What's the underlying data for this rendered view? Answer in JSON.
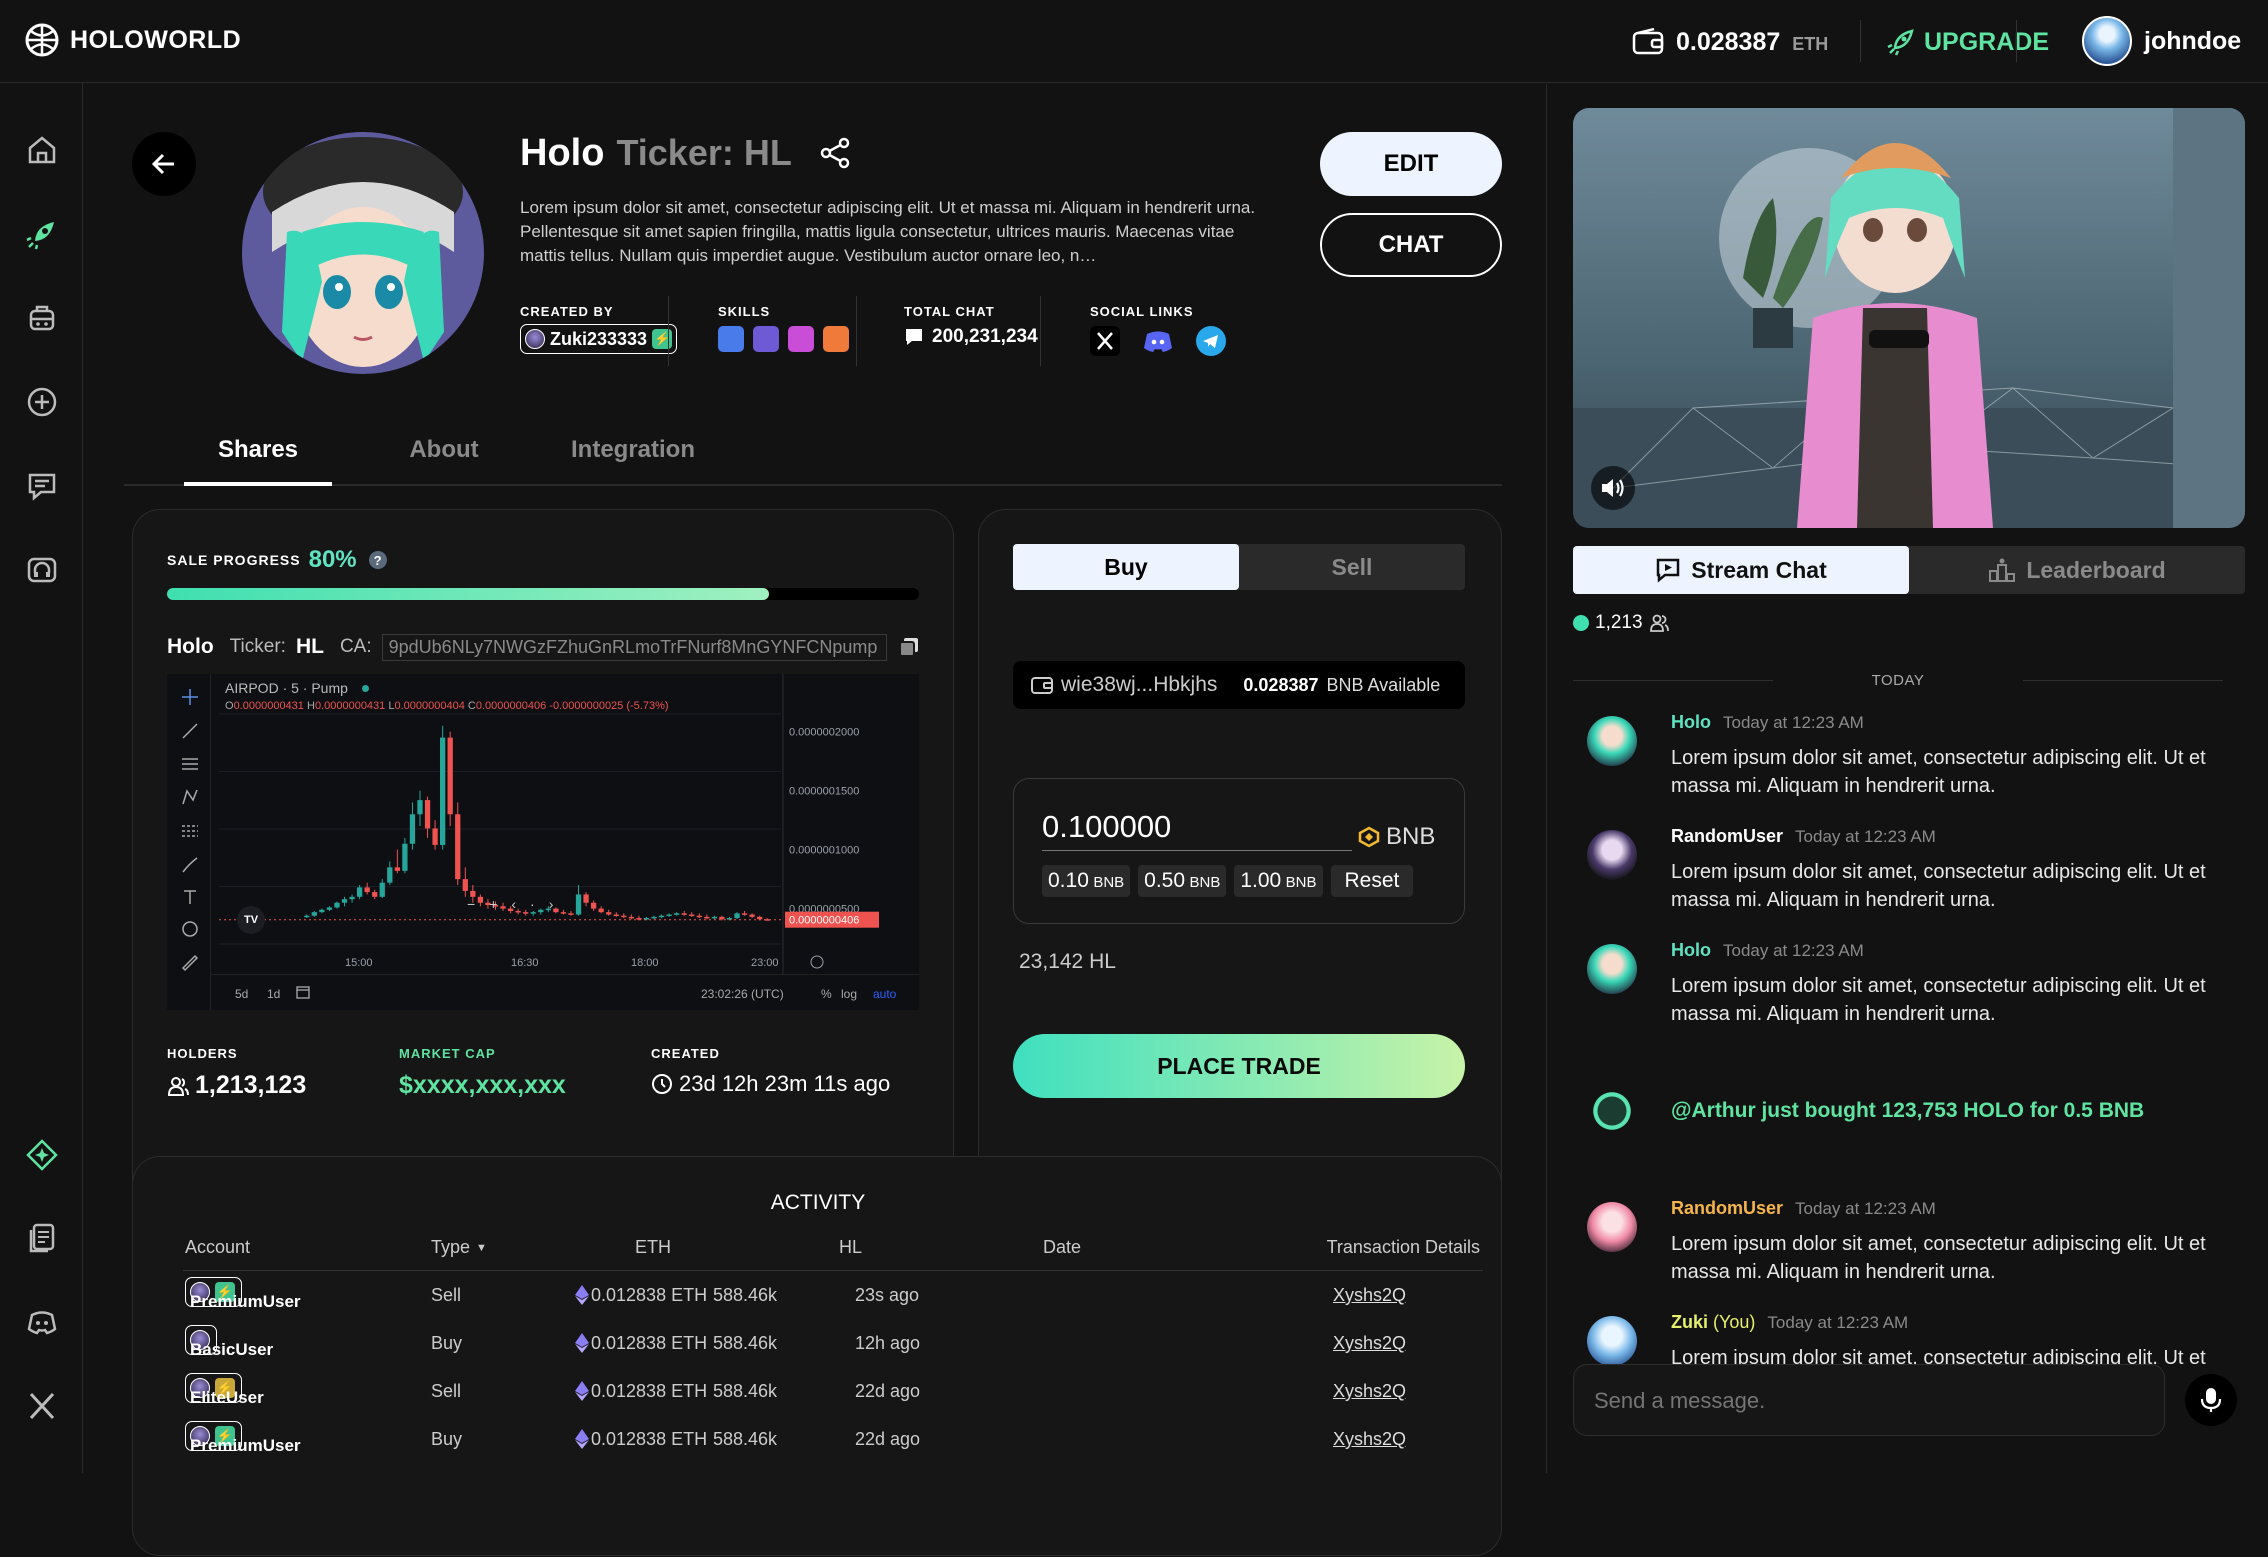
{
  "topbar": {
    "brand": "HOLOWORLD",
    "balance_value": "0.028387",
    "balance_unit": "ETH",
    "upgrade_label": "UPGRADE",
    "username": "johndoe"
  },
  "profile": {
    "name": "Holo",
    "ticker": "Ticker: HL",
    "description": "Lorem ipsum dolor sit amet, consectetur adipiscing elit. Ut et massa mi. Aliquam in hendrerit urna. Pellentesque sit amet sapien fringilla, mattis ligula consectetur, ultrices mauris. Maecenas vitae mattis tellus. Nullam quis imperdiet augue. Vestibulum auctor ornare leo, n…",
    "created_by_label": "CREATED BY",
    "creator": "Zuki233333",
    "skills_label": "SKILLS",
    "total_chat_label": "TOTAL CHAT",
    "total_chat": "200,231,234",
    "social_label": "SOCIAL LINKS",
    "edit_label": "EDIT",
    "chat_label": "CHAT"
  },
  "tabs": [
    {
      "label": "Shares",
      "active": true
    },
    {
      "label": "About",
      "active": false
    },
    {
      "label": "Integration",
      "active": false
    }
  ],
  "sale": {
    "label": "SALE PROGRESS",
    "percent_text": "80%",
    "progress": 0.8,
    "token_name": "Holo",
    "ticker_label": "Ticker:",
    "ticker": "HL",
    "ca_label": "CA:",
    "ca": "9pdUb6NLy7NWGzFZhuGnRLmoTrFNurf8MnGYNFCNpump"
  },
  "chart_data": {
    "type": "candlestick",
    "title": "AIRPOD · 5 · Pump",
    "ohlc_text": {
      "o": "0.0000000431",
      "h": "0.0000000431",
      "l": "0.0000000404",
      "c": "0.0000000406",
      "chg": "-0.0000000025 (-5.73%)"
    },
    "y_ticks": [
      "0.0000002000",
      "0.0000001500",
      "0.0000001000",
      "0.0000000500"
    ],
    "last_price": "0.0000000406",
    "x_ticks": [
      "15:00",
      "16:30",
      "18:00",
      "23:00"
    ],
    "timeframes": [
      "5d",
      "1d"
    ],
    "clock": "23:02:26 (UTC)",
    "scale_opts": [
      "%",
      "log",
      "auto"
    ],
    "candles": [
      [
        43,
        45,
        42,
        44
      ],
      [
        44,
        48,
        43,
        47
      ],
      [
        47,
        50,
        46,
        49
      ],
      [
        49,
        52,
        48,
        51
      ],
      [
        51,
        56,
        50,
        55
      ],
      [
        55,
        60,
        52,
        58
      ],
      [
        58,
        62,
        55,
        60
      ],
      [
        60,
        70,
        58,
        68
      ],
      [
        68,
        72,
        62,
        64
      ],
      [
        64,
        66,
        58,
        60
      ],
      [
        60,
        75,
        59,
        72
      ],
      [
        72,
        90,
        70,
        85
      ],
      [
        85,
        100,
        80,
        82
      ],
      [
        82,
        110,
        80,
        105
      ],
      [
        105,
        140,
        100,
        130
      ],
      [
        130,
        150,
        120,
        142
      ],
      [
        142,
        145,
        110,
        118
      ],
      [
        118,
        125,
        100,
        104
      ],
      [
        104,
        205,
        100,
        195
      ],
      [
        195,
        200,
        120,
        130
      ],
      [
        130,
        140,
        70,
        75
      ],
      [
        75,
        85,
        60,
        65
      ],
      [
        65,
        70,
        55,
        60
      ],
      [
        60,
        62,
        52,
        55
      ],
      [
        55,
        58,
        50,
        53
      ],
      [
        53,
        56,
        49,
        52
      ],
      [
        52,
        55,
        48,
        50
      ],
      [
        50,
        52,
        46,
        48
      ],
      [
        48,
        50,
        45,
        47
      ],
      [
        47,
        49,
        44,
        46
      ],
      [
        46,
        48,
        44,
        47
      ],
      [
        47,
        50,
        45,
        49
      ],
      [
        49,
        52,
        47,
        50
      ],
      [
        50,
        51,
        46,
        47
      ],
      [
        47,
        49,
        45,
        46
      ],
      [
        46,
        48,
        44,
        45
      ],
      [
        45,
        70,
        44,
        62
      ],
      [
        62,
        64,
        52,
        55
      ],
      [
        55,
        57,
        48,
        50
      ],
      [
        50,
        52,
        46,
        47
      ],
      [
        47,
        49,
        44,
        45
      ],
      [
        45,
        47,
        43,
        44
      ],
      [
        44,
        46,
        42,
        43
      ],
      [
        43,
        45,
        41,
        42
      ],
      [
        42,
        44,
        40,
        41
      ],
      [
        41,
        43,
        40,
        42
      ],
      [
        42,
        44,
        41,
        43
      ],
      [
        43,
        45,
        42,
        44
      ],
      [
        44,
        46,
        43,
        45
      ],
      [
        45,
        47,
        44,
        46
      ],
      [
        46,
        48,
        44,
        45
      ],
      [
        45,
        47,
        43,
        44
      ],
      [
        44,
        46,
        42,
        43
      ],
      [
        43,
        45,
        41,
        42
      ],
      [
        42,
        44,
        41,
        43
      ],
      [
        43,
        44,
        40,
        41
      ],
      [
        41,
        43,
        40,
        42
      ],
      [
        42,
        47,
        41,
        46
      ],
      [
        46,
        48,
        44,
        45
      ],
      [
        45,
        46,
        42,
        43
      ],
      [
        43,
        44,
        40,
        41
      ],
      [
        41,
        42,
        40,
        40.6
      ]
    ]
  },
  "stats": {
    "holders_label": "HOLDERS",
    "holders": "1,213,123",
    "mcap_label": "MARKET CAP",
    "mcap": "$xxxx,xxx,xxx",
    "created_label": "CREATED",
    "created": "23d 12h 23m 11s ago"
  },
  "trade": {
    "buy_label": "Buy",
    "sell_label": "Sell",
    "wallet": "wie38wj...Hbkjhs",
    "available_value": "0.028387",
    "available_unit": "BNB Available",
    "amount": "0.100000",
    "currency": "BNB",
    "presets": [
      {
        "value": "0.10",
        "unit": "BNB"
      },
      {
        "value": "0.50",
        "unit": "BNB"
      },
      {
        "value": "1.00",
        "unit": "BNB"
      }
    ],
    "reset_label": "Reset",
    "receive": "23,142 HL",
    "place_label": "PLACE TRADE"
  },
  "activity": {
    "title": "ACTIVITY",
    "headers": {
      "account": "Account",
      "type": "Type",
      "eth": "ETH",
      "hl": "HL",
      "date": "Date",
      "tx": "Transaction Details"
    },
    "rows": [
      {
        "account": "PremiumUser",
        "tier": "premium",
        "type": "Sell",
        "eth": "0.012838 ETH",
        "hl": "588.46k",
        "date": "23s ago",
        "tx": "Xyshs2Q"
      },
      {
        "account": "BasicUser",
        "tier": "basic",
        "type": "Buy",
        "eth": "0.012838 ETH",
        "hl": "588.46k",
        "date": "12h ago",
        "tx": "Xyshs2Q"
      },
      {
        "account": "EliteUser",
        "tier": "elite",
        "type": "Sell",
        "eth": "0.012838 ETH",
        "hl": "588.46k",
        "date": "22d ago",
        "tx": "Xyshs2Q"
      },
      {
        "account": "PremiumUser",
        "tier": "premium",
        "type": "Buy",
        "eth": "0.012838 ETH",
        "hl": "588.46k",
        "date": "22d ago",
        "tx": "Xyshs2Q"
      }
    ]
  },
  "stream": {
    "chat_tab": "Stream Chat",
    "leaderboard_tab": "Leaderboard",
    "viewers": "1,213",
    "divider": "TODAY",
    "messages": [
      {
        "name": "Holo",
        "suffix": "",
        "color": "#5fe3c0",
        "time": "Today at 12:23 AM",
        "text": "Lorem ipsum dolor sit amet, consectetur adipiscing elit. Ut et massa mi. Aliquam in hendrerit urna."
      },
      {
        "name": "RandomUser",
        "suffix": "",
        "color": "#ffffff",
        "time": "Today at 12:23 AM",
        "text": "Lorem ipsum dolor sit amet, consectetur adipiscing elit. Ut et massa mi. Aliquam in hendrerit urna."
      },
      {
        "name": "Holo",
        "suffix": "",
        "color": "#5fe3c0",
        "time": "Today at 12:23 AM",
        "text": "Lorem ipsum dolor sit amet, consectetur adipiscing elit. Ut et massa mi. Aliquam in hendrerit urna."
      },
      {
        "name": "RandomUser",
        "suffix": "",
        "color": "#f5b54a",
        "time": "Today at 12:23 AM",
        "text": "Lorem ipsum dolor sit amet, consectetur adipiscing elit. Ut et massa mi. Aliquam in hendrerit urna."
      },
      {
        "name": "Zuki",
        "suffix": "(You)",
        "color": "#e5f06a",
        "time": "Today at 12:23 AM",
        "text": "Lorem ipsum dolor sit amet, consectetur adipiscing elit. Ut et massa mi. Aliquam in hendrerit urna."
      }
    ],
    "event": "@Arthur just bought 123,753 HOLO for 0.5 BNB",
    "input_placeholder": "Send a message."
  }
}
